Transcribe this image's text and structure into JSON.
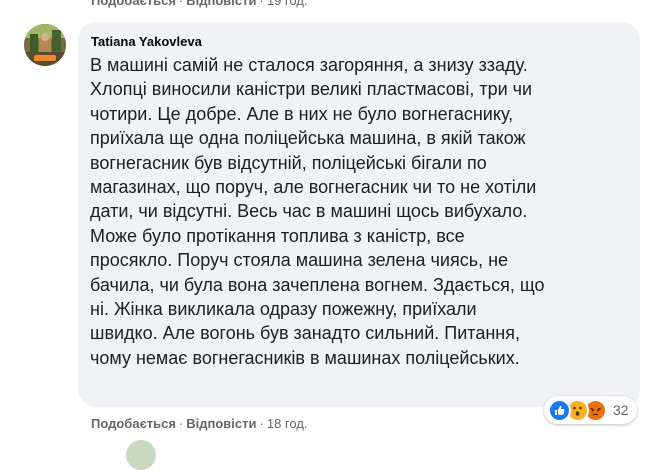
{
  "previous_comment_footer": {
    "like": "Подобається",
    "separator": "·",
    "reply": "Відповісти",
    "time": "19 год."
  },
  "comment": {
    "author": "Tatiana Yakovleva",
    "text": "В машині самій не сталося загоряння, а знизу ззаду.\nХлопці виносили каністри великі пластмасові, три чи\nчотири. Це добре. Але в них не було вогнегаснику,\nприїхала ще одна поліцейська машина, в якій також\nвогнегасник був відсутній, поліцейські бігали по\nмагазинах, що поруч, але вогнегасник чи то не хотіли\nдати, чи відсутні. Весь час в машині щось вибухало.\nМоже було протікання топлива з каністр, все\nпросякло. Поруч стояла машина зелена чиясь, не\nбачила, чи була вона зачеплена вогнем. Здається, що\nні. Жінка викликала одразу пожежну, приїхали\nшвидко. Але вогонь був занадто сильний. Питання,\nчому немає вогнегасників в машинах поліцейських.",
    "reactions": {
      "icons": [
        "like-icon",
        "wow-icon",
        "angry-icon"
      ],
      "count": "32"
    },
    "footer": {
      "like": "Подобається",
      "separator": "·",
      "reply": "Відповісти",
      "time": "18 год."
    }
  },
  "colors": {
    "bubble": "#f0f2f5",
    "secondary_text": "#65676b",
    "like_blue": "#1877f2",
    "wow_yellow": "#f7b125",
    "angry_orange": "#e9710f"
  }
}
